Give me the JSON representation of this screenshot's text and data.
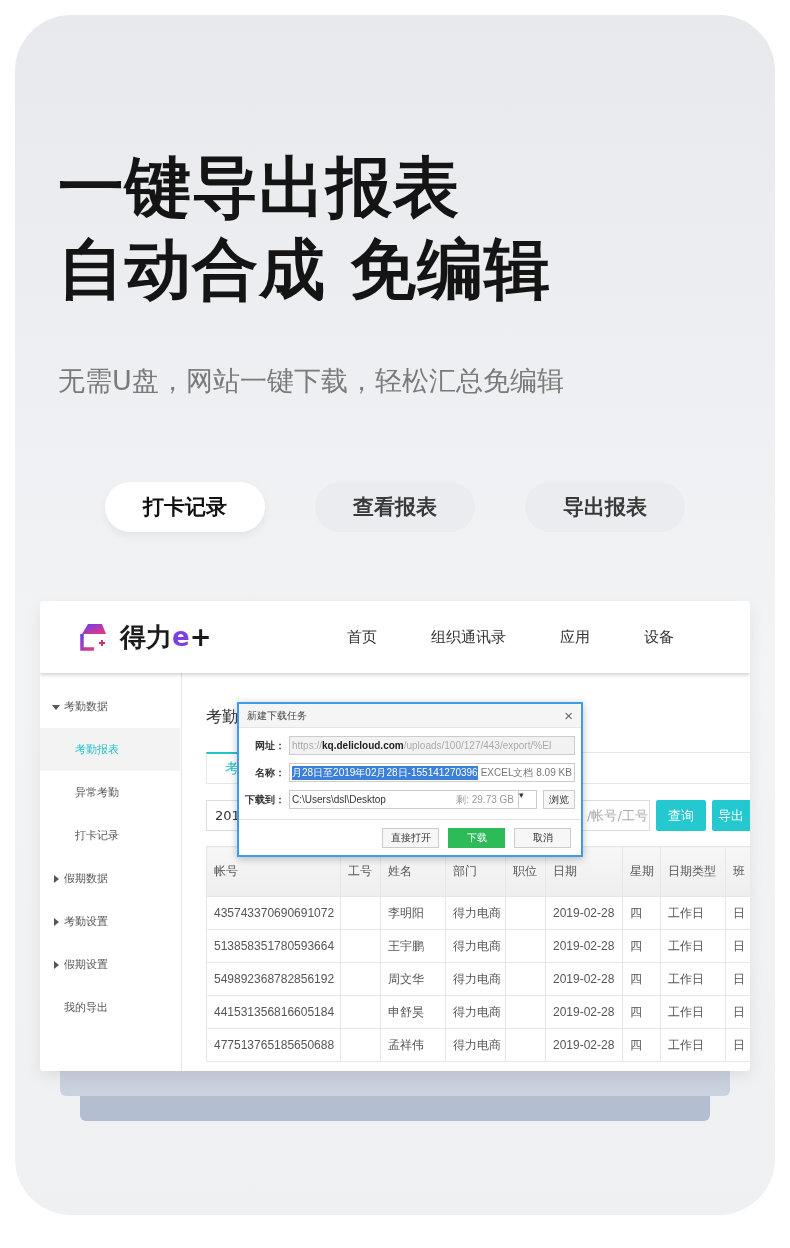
{
  "headline": [
    "一键导出报表",
    "自动合成 免编辑"
  ],
  "subtitle": "无需U盘，网站一键下载，轻松汇总免编辑",
  "pills": [
    {
      "label": "打卡记录",
      "selected": true
    },
    {
      "label": "查看报表",
      "selected": false
    },
    {
      "label": "导出报表",
      "selected": false
    }
  ],
  "app": {
    "logo": {
      "name": "得力",
      "mark": "e",
      "plus": "+"
    },
    "nav": [
      "首页",
      "组织通讯录",
      "应用",
      "设备"
    ],
    "sidebar": [
      {
        "kind": "group",
        "label": "考勤数据",
        "expanded": true,
        "children": [
          {
            "label": "考勤报表",
            "selected": true
          },
          {
            "label": "异常考勤",
            "selected": false
          },
          {
            "label": "打卡记录",
            "selected": false
          }
        ]
      },
      {
        "kind": "group",
        "label": "假期数据",
        "expanded": false
      },
      {
        "kind": "group",
        "label": "考勤设置",
        "expanded": false
      },
      {
        "kind": "group",
        "label": "假期设置",
        "expanded": false
      },
      {
        "kind": "link",
        "label": "我的导出"
      }
    ],
    "page_title": "考勤",
    "tab": {
      "label": "考",
      "selected": true
    },
    "date_value": "201",
    "keyword_placeholder": "/帐号/工号",
    "buttons": [
      "查询",
      "导出"
    ],
    "table": {
      "columns": [
        "帐号",
        "工号",
        "姓名",
        "部门",
        "职位",
        "日期",
        "星期",
        "日期类型",
        "班"
      ],
      "rows": [
        {
          "account": "435743370690691072",
          "name": "李明阳",
          "dept": "得力电商",
          "date": "2019-02-28",
          "weekday": "四",
          "day_type": "工作日",
          "column_9": "日"
        },
        {
          "account": "513858351780593664",
          "name": "王宇鹏",
          "dept": "得力电商",
          "date": "2019-02-28",
          "weekday": "四",
          "day_type": "工作日",
          "column_9": "日"
        },
        {
          "account": "549892368782856192",
          "name": "周文华",
          "dept": "得力电商",
          "date": "2019-02-28",
          "weekday": "四",
          "day_type": "工作日",
          "column_9": "日"
        },
        {
          "account": "441531356816605184",
          "name": "申舒昊",
          "dept": "得力电商",
          "date": "2019-02-28",
          "weekday": "四",
          "day_type": "工作日",
          "column_9": "日"
        },
        {
          "account": "477513765185650688",
          "name": "孟祥伟",
          "dept": "得力电商",
          "date": "2019-02-28",
          "weekday": "四",
          "day_type": "工作日",
          "column_9": "日"
        }
      ]
    },
    "dialog": {
      "title": "新建下载任务",
      "close": "×",
      "url_label": "网址：",
      "url": {
        "scheme": "https://",
        "host": "kq.delicloud.com",
        "path": "/uploads/100/127/443/export/%EI"
      },
      "name_label": "名称：",
      "name_value": "月28日至2019年02月28日-155141270396",
      "file_info": "EXCEL文档 8.09 KB",
      "save_label": "下载到：",
      "save_path": "C:\\Users\\dsl\\Desktop",
      "free_space": "剩: 29.73 GB",
      "dropdown": "▾",
      "browse": "浏览",
      "actions": [
        {
          "label": "直接打开",
          "primary": false
        },
        {
          "label": "下载",
          "primary": true
        },
        {
          "label": "取消",
          "primary": false
        }
      ]
    }
  }
}
